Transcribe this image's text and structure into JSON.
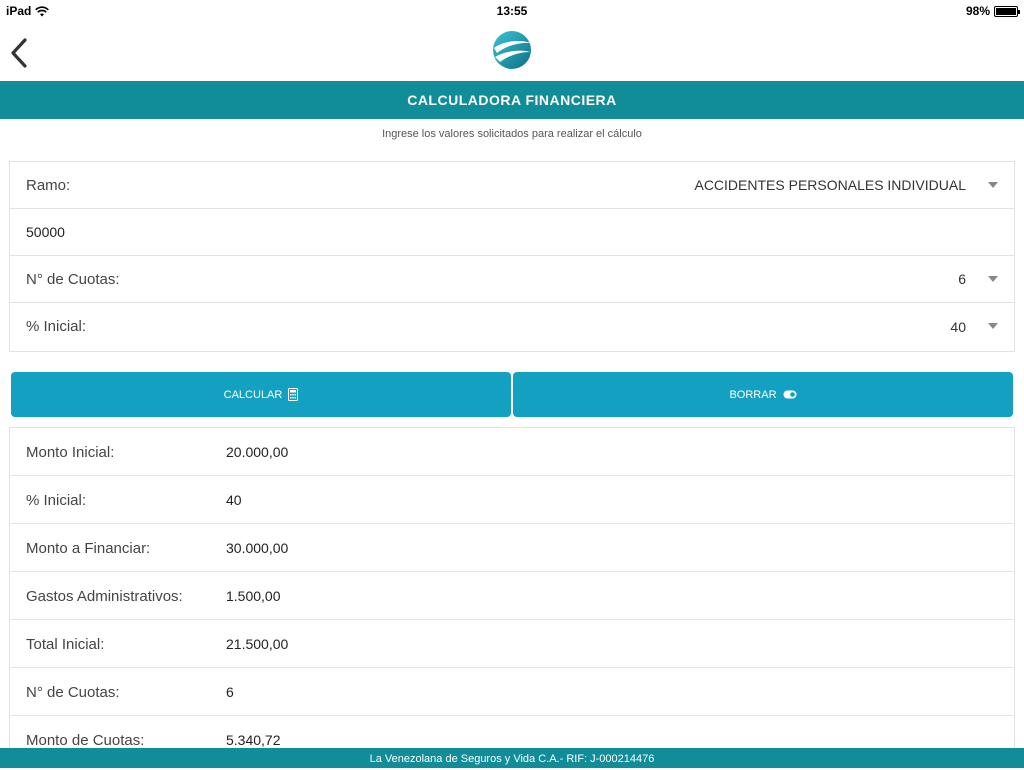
{
  "status_bar": {
    "device": "iPad",
    "time": "13:55",
    "battery": "98%",
    "battery_level": 0.98
  },
  "header": {
    "title": "CALCULADORA FINANCIERA",
    "subtitle": "Ingrese los valores solicitados para realizar el cálculo"
  },
  "form": {
    "ramo_label": "Ramo:",
    "ramo_value": "ACCIDENTES PERSONALES INDIVIDUAL",
    "amount_value": "50000",
    "cuotas_label": "N° de Cuotas:",
    "cuotas_value": "6",
    "inicial_label": "% Inicial:",
    "inicial_value": "40"
  },
  "buttons": {
    "calcular": "CALCULAR",
    "borrar": "BORRAR"
  },
  "results": [
    {
      "label": "Monto Inicial:",
      "value": "20.000,00"
    },
    {
      "label": "% Inicial:",
      "value": "40"
    },
    {
      "label": "Monto a Financiar:",
      "value": "30.000,00"
    },
    {
      "label": "Gastos Administrativos:",
      "value": "1.500,00"
    },
    {
      "label": "Total Inicial:",
      "value": "21.500,00"
    },
    {
      "label": "N° de Cuotas:",
      "value": "6"
    },
    {
      "label": "Monto de Cuotas:",
      "value": "5.340,72"
    }
  ],
  "footer": {
    "text": "La Venezolana de Seguros y Vida C.A.- RIF: J-000214476"
  },
  "colors": {
    "primary": "#118c99",
    "button": "#14a1c1"
  }
}
